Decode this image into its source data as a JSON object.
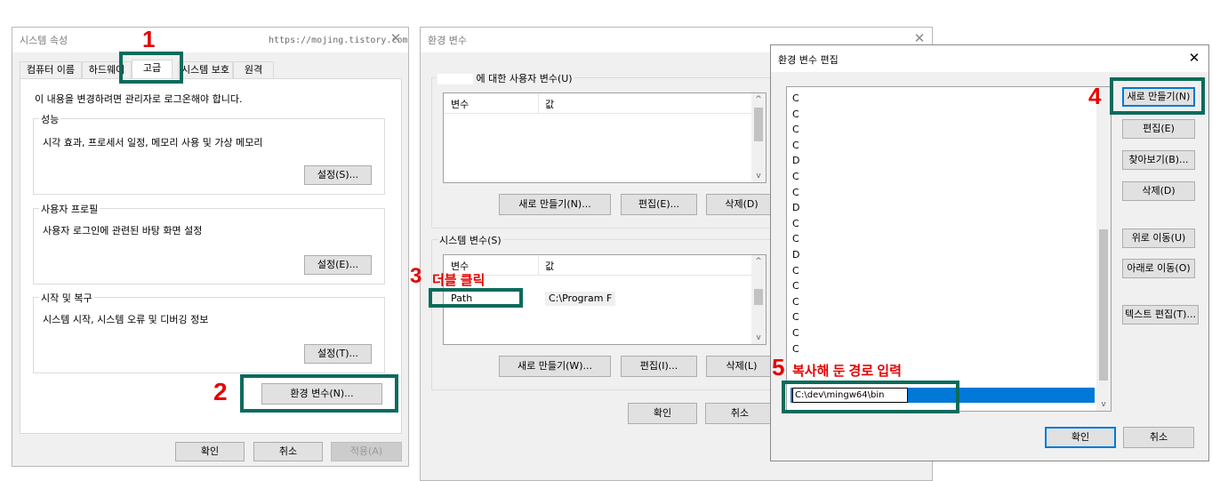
{
  "sysprops": {
    "title": "시스템 속성",
    "watermark": "https://mojing.tistory.com",
    "close": "✕",
    "tabs": [
      "컴퓨터 이름",
      "하드웨어",
      "고급",
      "시스템 보호",
      "원격"
    ],
    "admin_note": "이 내용을 변경하려면 관리자로 로그온해야 합니다.",
    "perf": {
      "title": "성능",
      "desc": "시각 효과, 프로세서 일정, 메모리 사용 및 가상 메모리",
      "button": "설정(S)..."
    },
    "profile": {
      "title": "사용자 프로필",
      "desc": "사용자 로그인에 관련된 바탕 화면 설정",
      "button": "설정(E)..."
    },
    "startup": {
      "title": "시작 및 복구",
      "desc": "시스템 시작, 시스템 오류 및 디버깅 정보",
      "button": "설정(T)..."
    },
    "env_button": "환경 변수(N)...",
    "ok": "확인",
    "cancel": "취소",
    "apply": "적용(A)"
  },
  "envvars": {
    "title": "환경 변수",
    "close": "✕",
    "user_group_title": "에 대한 사용자 변수(U)",
    "col_var": "변수",
    "col_val": "값",
    "user_buttons": {
      "new": "새로 만들기(N)...",
      "edit": "편집(E)...",
      "delete": "삭제(D)"
    },
    "sys_group_title": "시스템 변수(S)",
    "path_name": "Path",
    "path_value": "C:\\Program F",
    "sys_buttons": {
      "new": "새로 만들기(W)...",
      "edit": "편집(I)...",
      "delete": "삭제(L)"
    },
    "ok": "확인",
    "cancel": "취소"
  },
  "editenv": {
    "title": "환경 변수 편집",
    "close": "✕",
    "items": [
      "C",
      "C",
      "C",
      "C",
      "D",
      "C",
      "C",
      "D",
      "C",
      "C",
      "D",
      "C",
      "C",
      "C",
      "C",
      "C",
      "C"
    ],
    "edit_value": "C:\\dev\\mingw64\\bin",
    "buttons": {
      "new": "새로 만들기(N)",
      "edit": "편집(E)",
      "browse": "찾아보기(B)...",
      "delete": "삭제(D)",
      "up": "위로 이동(U)",
      "down": "아래로 이동(O)",
      "text_edit": "텍스트 편집(T)..."
    },
    "ok": "확인",
    "cancel": "취소"
  },
  "annotations": {
    "n1": "1",
    "n2": "2",
    "n3": "3",
    "n3_label": "더블 클릭",
    "n4": "4",
    "n5": "5",
    "n5_label": "복사해 둔 경로 입력",
    "color": "#e60000",
    "box_color": "#0a6b5c"
  }
}
